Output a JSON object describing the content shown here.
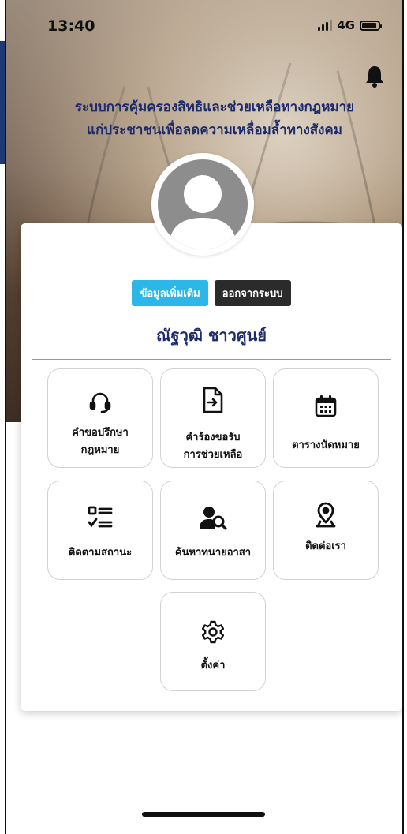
{
  "status_bar": {
    "time": "13:40",
    "network": "4G",
    "signal_bars": 3
  },
  "header": {
    "title_line1": "ระบบการคุ้มครองสิทธิและช่วยเหลือทางกฎหมาย",
    "title_line2": "แก่ประชาชนเพื่อลดความเหลื่อมล้ำทางสังคม"
  },
  "icons": {
    "notification": "bell-icon",
    "avatar": "user-avatar-icon"
  },
  "profile": {
    "more_info_label": "ข้อมูลเพิ่มเติม",
    "logout_label": "ออกจากระบบ",
    "user_name": "ณัฐวุฒิ ชาวศูนย์"
  },
  "menu": [
    {
      "icon": "headset-icon",
      "line1": "คำขอปรึกษา",
      "line2": "กฎหมาย"
    },
    {
      "icon": "file-arrow-icon",
      "line1": "คำร้องขอรับ",
      "line2": "การช่วยเหลือ"
    },
    {
      "icon": "calendar-icon",
      "line1": "ตารางนัดหมาย",
      "line2": ""
    },
    {
      "icon": "checklist-icon",
      "line1": "ติดตามสถานะ",
      "line2": ""
    },
    {
      "icon": "user-search-icon",
      "line1": "ค้นหาทนายอาสา",
      "line2": ""
    },
    {
      "icon": "location-pin-icon",
      "line1": "ติดต่อเรา",
      "line2": ""
    },
    {
      "icon": "gear-icon",
      "line1": "ตั้งค่า",
      "line2": ""
    }
  ],
  "colors": {
    "title": "#1d2a6b",
    "more_info_button": "#2cb7e8",
    "logout_button": "#2b2b2b",
    "avatar": "#8d8d8d"
  }
}
